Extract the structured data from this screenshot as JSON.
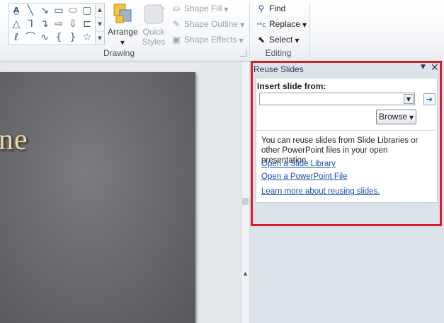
{
  "ribbon": {
    "drawing": {
      "group_label": "Drawing",
      "arrange_label": "Arrange",
      "quick_styles_line1": "Quick",
      "quick_styles_line2": "Styles",
      "shape_fill": "Shape Fill",
      "shape_outline": "Shape Outline",
      "shape_effects": "Shape Effects"
    },
    "editing": {
      "group_label": "Editing",
      "find": "Find",
      "replace": "Replace",
      "select": "Select"
    }
  },
  "slide": {
    "title_fragment": "ne"
  },
  "task_pane": {
    "title": "Reuse Slides",
    "insert_from_label": "Insert slide from:",
    "source_value": "",
    "browse_label": "Browse",
    "info_text": "You can reuse slides from Slide Libraries or other PowerPoint files in your open presentation.",
    "link_open_library": "Open a Slide Library",
    "link_open_file": "Open a PowerPoint File",
    "link_learn_more": "Learn more about reusing slides."
  },
  "colors": {
    "highlight_border": "#d3202e",
    "link": "#1a4fa8",
    "slide_background": "#6b6a6f",
    "slide_title": "#e9d7a0"
  }
}
